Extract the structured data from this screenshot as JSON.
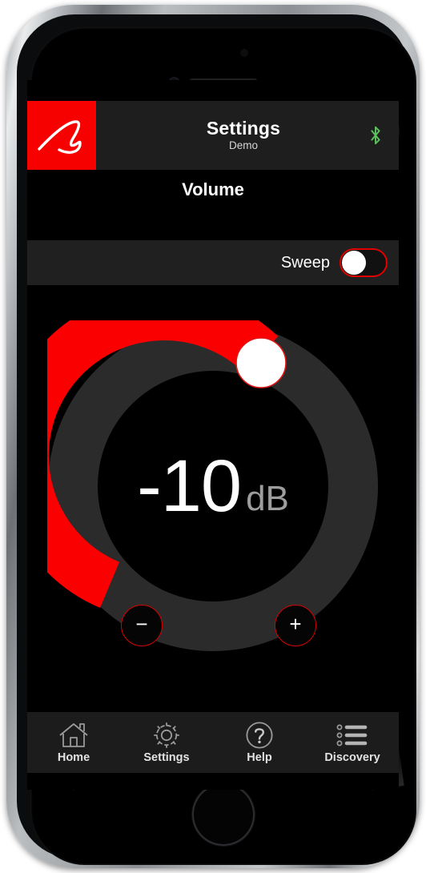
{
  "app": {
    "header": {
      "logo_icon": "martin-logan-signature-logo",
      "title": "Settings",
      "subtitle": "Demo",
      "bluetooth_icon": "bluetooth-icon",
      "bluetooth_color": "#5cc15c",
      "background_color": "#1e1e1e",
      "logo_background_color": "#f60000"
    },
    "section": {
      "title": "Volume"
    },
    "sweep_row": {
      "label": "Sweep",
      "toggle_state": "off",
      "toggle_border_color": "#e00000",
      "background_color": "#202020"
    },
    "dial": {
      "value": "-10",
      "unit": "dB",
      "min": -80,
      "max": 0,
      "percent": 70,
      "active_color": "#fa0000",
      "track_color": "#2b2b2b",
      "knob_icon": "dial-handle",
      "decrease_label": "−",
      "increase_label": "+"
    },
    "tabbar": {
      "background_color": "#1c1c1c",
      "items": [
        {
          "label": "Home",
          "icon": "home-icon"
        },
        {
          "label": "Settings",
          "icon": "gear-icon"
        },
        {
          "label": "Help",
          "icon": "question-circle-icon"
        },
        {
          "label": "Discovery",
          "icon": "list-icon"
        }
      ]
    },
    "device": {
      "home_button": "home-button",
      "earpiece": "earpiece-speaker",
      "front_camera": "front-camera",
      "proximity_sensor": "proximity-sensor"
    }
  }
}
